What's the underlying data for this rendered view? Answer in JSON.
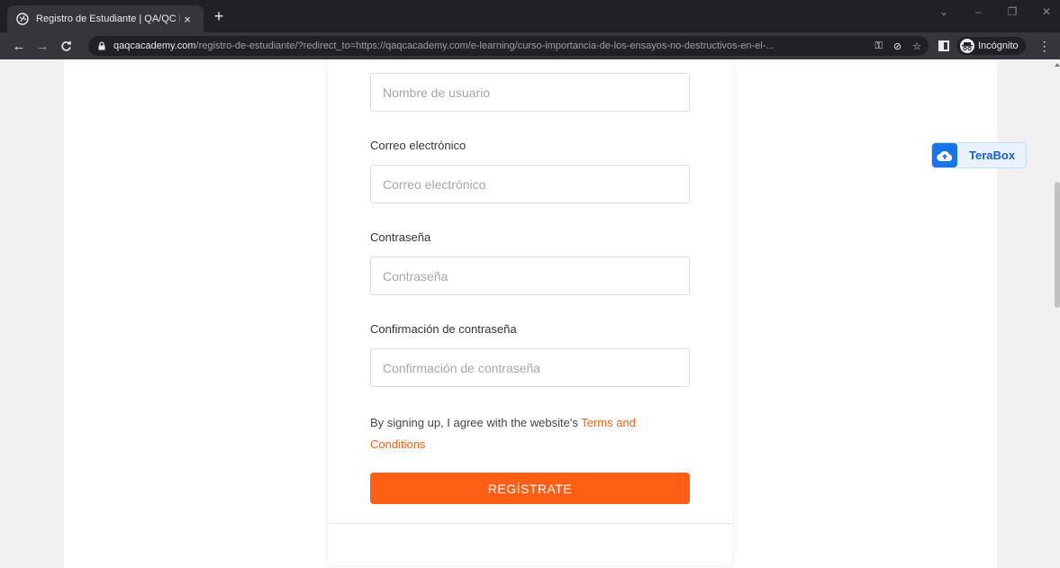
{
  "browser": {
    "tab_title": "Registro de Estudiante | QA/QC I",
    "tab_close": "×",
    "new_tab": "+",
    "url_host": "qaqcacademy.com",
    "url_path": "/registro-de-estudiante/?redirect_to=https://qaqcacademy.com/e-learning/curso-importancia-de-los-ensayos-no-destructivos-en-el-...",
    "incognito_label": "Incógnito",
    "menu": "⋮"
  },
  "form": {
    "username_placeholder": "Nombre de usuario",
    "email_label": "Correo electrónico",
    "email_placeholder": "Correo electrónico",
    "password_label": "Contraseña",
    "password_placeholder": "Contraseña",
    "confirm_label": "Confirmación de contraseña",
    "confirm_placeholder": "Confirmación de contraseña",
    "terms_text": "By signing up, I agree with the website's ",
    "terms_link": "Terms and Conditions",
    "submit_label": "REGÍSTRATE"
  },
  "widget": {
    "terabox_label": "TeraBox"
  },
  "colors": {
    "accent": "#ff5e14",
    "terabox_blue": "#1a73e8"
  }
}
